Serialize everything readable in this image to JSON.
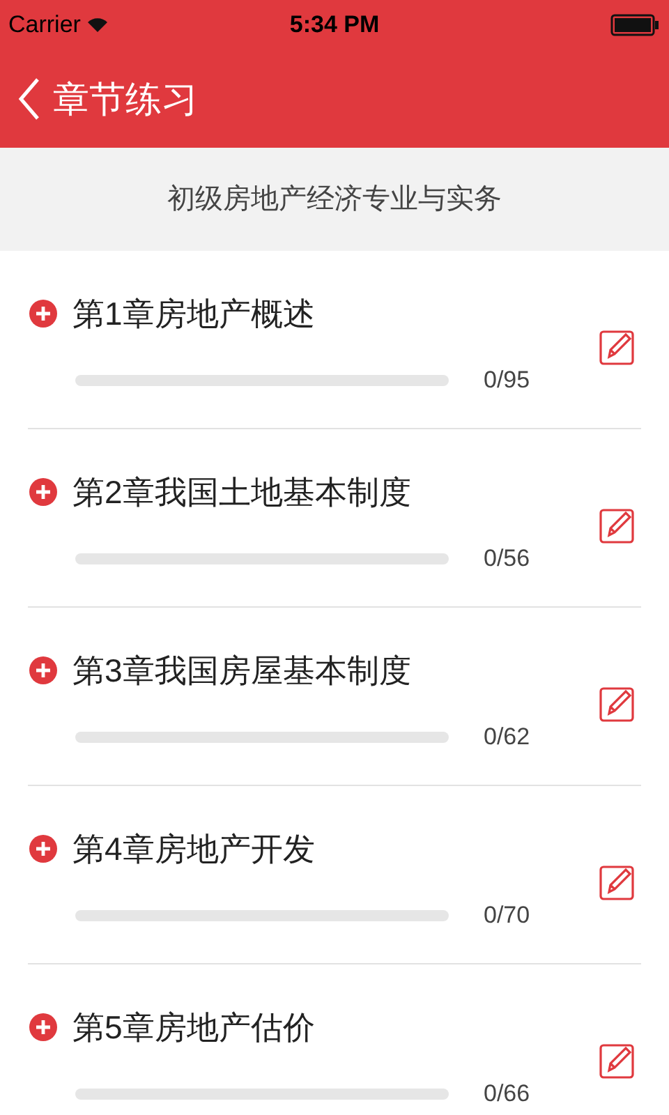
{
  "status_bar": {
    "carrier": "Carrier",
    "time": "5:34 PM"
  },
  "nav": {
    "title": "章节练习"
  },
  "subject": "初级房地产经济专业与实务",
  "chapters": [
    {
      "title": "第1章房地产概述",
      "level": 0,
      "count": "0/95"
    },
    {
      "title": "第2章我国土地基本制度",
      "level": 0,
      "count": "0/56"
    },
    {
      "title": "第3章我国房屋基本制度",
      "level": 0,
      "count": "0/62"
    },
    {
      "title": "第4章房地产开发",
      "level": 0,
      "count": "0/70"
    },
    {
      "title": "第5章房地产估价",
      "level": 0,
      "count": "0/66"
    }
  ]
}
